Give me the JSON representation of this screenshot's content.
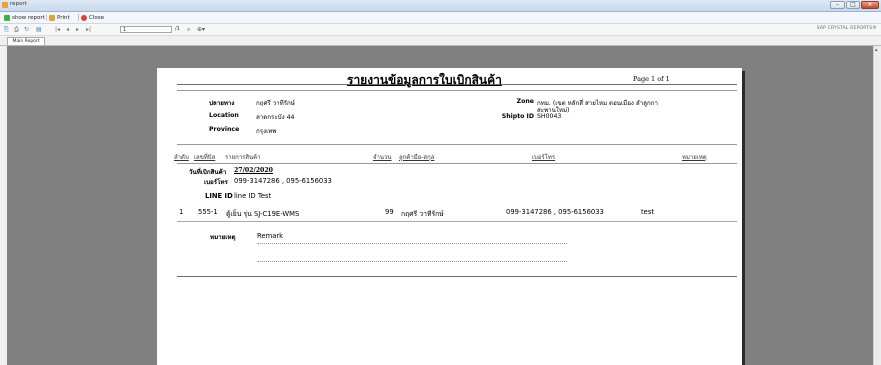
{
  "window": {
    "title": "report"
  },
  "toolbar": {
    "show_report": "show report",
    "print": "Print",
    "close": "Close"
  },
  "viewer_toolbar": {
    "page_input": "1",
    "page_total": "/1",
    "brand": "SAP CRYSTAL REPORTS®"
  },
  "tabs": [
    {
      "label": "Main Report"
    }
  ],
  "report": {
    "title": "รายงานข้อมูลการใบเบิกสินค้า",
    "page_info": "Page 1 of 1",
    "destination_label": "ปลายทาง",
    "destination_value": "กฤศรี วาทีรักษ์",
    "location_label": "Location",
    "location_value": "ลาดกระบัง 44",
    "province_label": "Province",
    "province_value": "กรุงเทพ",
    "zone_label": "Zone",
    "zone_value_line1": "กทม. (เขต หลักสี่ สายไหม ดอนเมือง ลำลูกกา",
    "zone_value_line2": "สะพานใหม่)",
    "shipto_label": "Shipto ID",
    "shipto_value": "SH0043",
    "columns": {
      "seq": "ลำดับ",
      "bill_no": "เลขที่บิล",
      "product": "รายการสินค้า",
      "qty": "จำนวน",
      "customer": "ลูกค้ามือ-สกุล",
      "phone": "เบอร์โทร",
      "note": "หมายเหตุ"
    },
    "group": {
      "date_label": "วันที่เบิกสินค้า",
      "date_value": "27/02/2020",
      "phone_label": "เบอร์โทร",
      "phone_value": "099-3147286 , 095-6156033",
      "line_label": "LINE ID",
      "line_value": "line ID Test"
    },
    "rows": [
      {
        "seq": "1",
        "bill_no": "555-1",
        "product": "ตู้เย็น รุ่น SJ-C19E-WMS",
        "qty": "99",
        "customer": "กฤศรี วาทีรักษ์",
        "phone": "099-3147286 , 095-6156033",
        "note": "test"
      }
    ],
    "remark_label": "หมายเหตุ",
    "remark_value": "Remark"
  }
}
